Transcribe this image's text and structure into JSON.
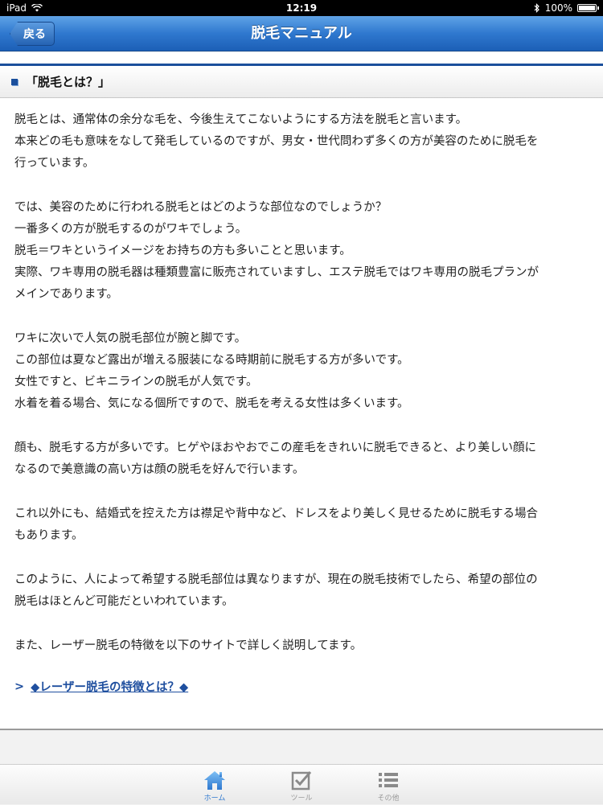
{
  "status_bar": {
    "device": "iPad",
    "time": "12:19",
    "battery": "100%",
    "battery_level": 1.0
  },
  "nav": {
    "back_label": "戻る",
    "title": "脱毛マニュアル"
  },
  "section": {
    "title": "「脱毛とは？」"
  },
  "content": {
    "paragraphs": [
      [
        "脱毛とは、通常体の余分な毛を、今後生えてこないようにする方法を脱毛と言います。",
        "本来どの毛も意味をなして発毛しているのですが、男女・世代問わず多くの方が美容のために脱毛を",
        "行っています。"
      ],
      [
        "では、美容のために行われる脱毛とはどのような部位なのでしょうか？",
        "一番多くの方が脱毛するのがワキでしょう。",
        "脱毛＝ワキというイメージをお持ちの方も多いことと思います。",
        "実際、ワキ専用の脱毛器は種類豊富に販売されていますし、エステ脱毛ではワキ専用の脱毛プランが",
        "メインであります。"
      ],
      [
        "ワキに次いで人気の脱毛部位が腕と脚です。",
        "この部位は夏など露出が増える服装になる時期前に脱毛する方が多いです。",
        "女性ですと、ビキニラインの脱毛が人気です。",
        "水着を着る場合、気になる個所ですので、脱毛を考える女性は多くいます。"
      ],
      [
        "顔も、脱毛する方が多いです。ヒゲやほおやおでこの産毛をきれいに脱毛できると、より美しい顔に",
        "なるので美意識の高い方は顔の脱毛を好んで行います。"
      ],
      [
        "これ以外にも、結婚式を控えた方は襟足や背中など、ドレスをより美しく見せるために脱毛する場合",
        "もあります。"
      ],
      [
        "このように、人によって希望する脱毛部位は異なりますが、現在の脱毛技術でしたら、希望の部位の",
        "脱毛はほとんど可能だといわれています。"
      ],
      [
        "また、レーザー脱毛の特徴を以下のサイトで詳しく説明してます。"
      ]
    ],
    "link_chevron": ">",
    "link_text": "◆レーザー脱毛の特徴とは？◆"
  },
  "tabbar": {
    "items": [
      {
        "label": "ホーム",
        "icon": "home-icon",
        "active": true
      },
      {
        "label": "ツール",
        "icon": "checkbox-icon",
        "active": false
      },
      {
        "label": "その他",
        "icon": "list-icon",
        "active": false
      }
    ]
  },
  "colors": {
    "nav_blue": "#2f78cf",
    "accent_dark_blue": "#1a4f9c",
    "link_blue": "#1f4f9f"
  }
}
